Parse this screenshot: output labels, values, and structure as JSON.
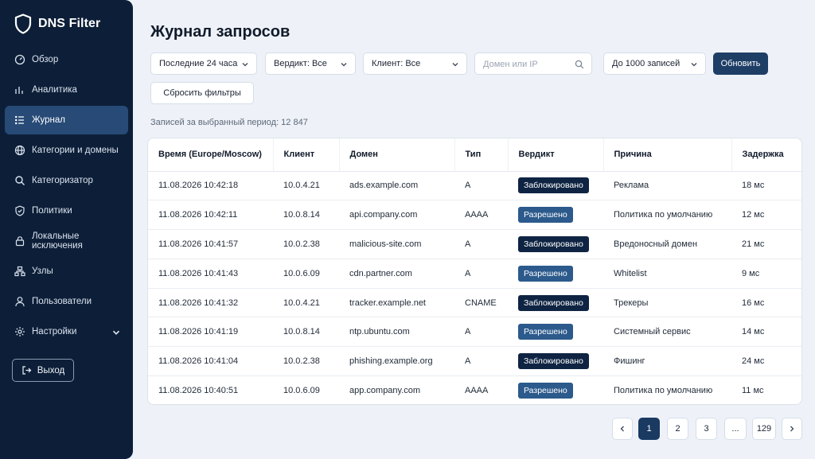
{
  "app": {
    "name": "DNS Filter"
  },
  "sidebar": {
    "items": [
      {
        "label": "Обзор",
        "icon": "gauge-icon"
      },
      {
        "label": "Аналитика",
        "icon": "chart-icon"
      },
      {
        "label": "Журнал",
        "icon": "list-icon",
        "active": true
      },
      {
        "label": "Категории и домены",
        "icon": "globe-icon"
      },
      {
        "label": "Категоризатор",
        "icon": "search-icon"
      },
      {
        "label": "Политики",
        "icon": "shield-check-icon"
      },
      {
        "label": "Локальные исключения",
        "icon": "lock-icon"
      },
      {
        "label": "Узлы",
        "icon": "network-icon"
      },
      {
        "label": "Пользователи",
        "icon": "user-icon"
      },
      {
        "label": "Настройки",
        "icon": "gear-icon"
      }
    ],
    "logout_label": "Выход"
  },
  "page": {
    "title": "Журнал запросов"
  },
  "filters": {
    "period": "Последние 24 часа",
    "verdict": "Вердикт: Все",
    "client": "Клиент: Все",
    "search_placeholder": "Домен или IP",
    "search_value": "",
    "limit": "До 1000 записей",
    "refresh_label": "Обновить",
    "reset_label": "Сбросить фильтры"
  },
  "records_text": "Записей за выбранный период: 12 847",
  "table": {
    "columns": [
      "Время (Europe/Moscow)",
      "Клиент",
      "Домен",
      "Тип",
      "Вердикт",
      "Причина",
      "Задержка"
    ],
    "rows": [
      {
        "time": "11.08.2026 10:42:18",
        "client": "10.0.4.21",
        "domain": "ads.example.com",
        "type": "A",
        "verdict": "Заблокировано",
        "verdict_kind": "blocked",
        "reason": "Реклама",
        "latency": "18 мс"
      },
      {
        "time": "11.08.2026 10:42:11",
        "client": "10.0.8.14",
        "domain": "api.company.com",
        "type": "AAAA",
        "verdict": "Разрешено",
        "verdict_kind": "allowed",
        "reason": "Политика по умолчанию",
        "latency": "12 мс"
      },
      {
        "time": "11.08.2026 10:41:57",
        "client": "10.0.2.38",
        "domain": "malicious-site.com",
        "type": "A",
        "verdict": "Заблокировано",
        "verdict_kind": "blocked",
        "reason": "Вредоносный домен",
        "latency": "21 мс"
      },
      {
        "time": "11.08.2026 10:41:43",
        "client": "10.0.6.09",
        "domain": "cdn.partner.com",
        "type": "A",
        "verdict": "Разрешено",
        "verdict_kind": "allowed",
        "reason": "Whitelist",
        "latency": "9 мс"
      },
      {
        "time": "11.08.2026 10:41:32",
        "client": "10.0.4.21",
        "domain": "tracker.example.net",
        "type": "CNAME",
        "verdict": "Заблокировано",
        "verdict_kind": "blocked",
        "reason": "Трекеры",
        "latency": "16 мс"
      },
      {
        "time": "11.08.2026 10:41:19",
        "client": "10.0.8.14",
        "domain": "ntp.ubuntu.com",
        "type": "A",
        "verdict": "Разрешено",
        "verdict_kind": "allowed",
        "reason": "Системный сервис",
        "latency": "14 мс"
      },
      {
        "time": "11.08.2026 10:41:04",
        "client": "10.0.2.38",
        "domain": "phishing.example.org",
        "type": "A",
        "verdict": "Заблокировано",
        "verdict_kind": "blocked",
        "reason": "Фишинг",
        "latency": "24 мс"
      },
      {
        "time": "11.08.2026 10:40:51",
        "client": "10.0.6.09",
        "domain": "app.company.com",
        "type": "AAAA",
        "verdict": "Разрешено",
        "verdict_kind": "allowed",
        "reason": "Политика по умолчанию",
        "latency": "11 мс"
      }
    ]
  },
  "pagination": {
    "pages": [
      "1",
      "2",
      "3",
      "...",
      "129"
    ],
    "current": "1",
    "prev_icon": "chevron-left-icon",
    "next_icon": "chevron-right-icon"
  },
  "colors": {
    "sidebar_bg": "#0d1f38",
    "sidebar_active": "#274a77",
    "primary": "#1e3e66",
    "badge_blocked": "#0f2443",
    "badge_allowed": "#2c5a8c",
    "page_bg": "#eef2f8"
  }
}
